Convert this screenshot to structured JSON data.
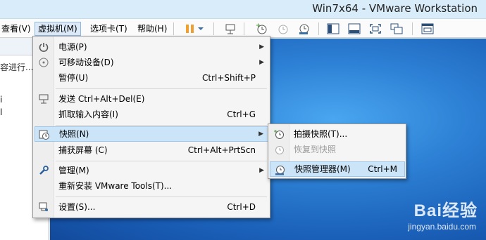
{
  "window": {
    "title": "Win7x64 - VMware Workstation"
  },
  "menubar": {
    "items": [
      {
        "label": "查看(V)"
      },
      {
        "label": "虚拟机(M)"
      },
      {
        "label": "选项卡(T)"
      },
      {
        "label": "帮助(H)"
      }
    ]
  },
  "left_pane": {
    "status": "容进行...",
    "marks": [
      "i",
      "l"
    ]
  },
  "vm_menu": {
    "items": [
      {
        "label": "电源(P)",
        "shortcut": ""
      },
      {
        "label": "可移动设备(D)",
        "shortcut": ""
      },
      {
        "label": "暂停(U)",
        "shortcut": "Ctrl+Shift+P"
      },
      {
        "label": "发送 Ctrl+Alt+Del(E)",
        "shortcut": ""
      },
      {
        "label": "抓取输入内容(I)",
        "shortcut": "Ctrl+G"
      },
      {
        "label": "快照(N)",
        "shortcut": ""
      },
      {
        "label": "捕获屏幕 (C)",
        "shortcut": "Ctrl+Alt+PrtScn"
      },
      {
        "label": "管理(M)",
        "shortcut": ""
      },
      {
        "label": "重新安装 VMware Tools(T)...",
        "shortcut": ""
      },
      {
        "label": "设置(S)...",
        "shortcut": "Ctrl+D"
      }
    ]
  },
  "snapshot_menu": {
    "items": [
      {
        "label": "拍摄快照(T)...",
        "shortcut": ""
      },
      {
        "label": "恢复到快照",
        "shortcut": ""
      },
      {
        "label": "快照管理器(M)",
        "shortcut": "Ctrl+M"
      }
    ]
  },
  "watermark": {
    "brand": "Bai经验",
    "url": "jingyan.baidu.com"
  },
  "colors": {
    "accent": "#cce4f7",
    "desktop": "#2c7fd4",
    "pause": "#f0a030"
  }
}
